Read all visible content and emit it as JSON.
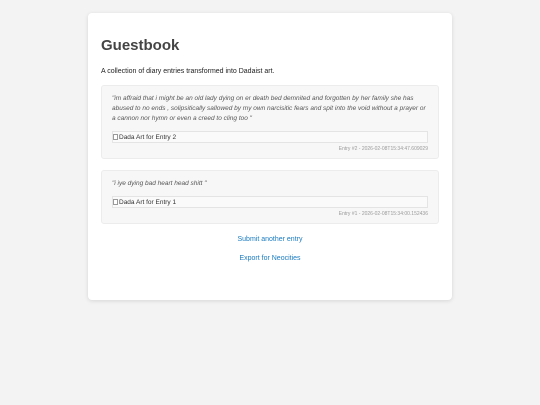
{
  "page": {
    "title": "Guestbook",
    "subtitle": "A collection of diary entries transformed into Dadaist art."
  },
  "entries": [
    {
      "text": "\"im affraid that i might be an old lady dying on er death bed demnited and forgotten by her family she has abused to no ends , solipsitically sallowed by my own narcisitic fears and spit into the void without a prayer or a cannon nor hymn or even a creed to cling too \"",
      "image_alt": "Dada Art for Entry 2",
      "meta": "Entry #2 - 2026-02-08T15:34:47.609029"
    },
    {
      "text": "\"i iye dying bad heart head shitt \"",
      "image_alt": "Dada Art for Entry 1",
      "meta": "Entry #1 - 2026-02-08T15:34:00.152436"
    }
  ],
  "links": {
    "submit": "Submit another entry",
    "export": "Export for Neocities"
  },
  "colors": {
    "background": "#f3f3f3",
    "card": "#ffffff",
    "link": "#1a7bc0",
    "entry_bg": "#f7f7f7"
  }
}
